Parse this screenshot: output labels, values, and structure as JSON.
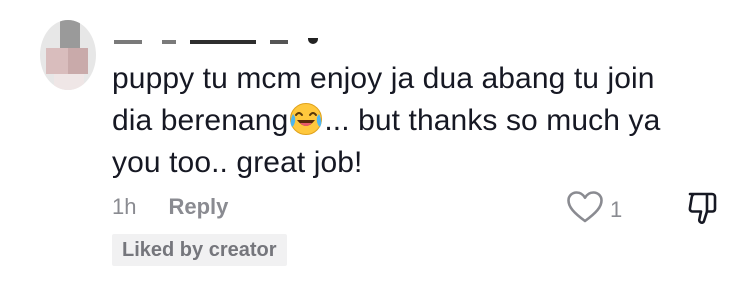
{
  "comment": {
    "text_line1": "puppy tu mcm enjoy ja dua abang tu join",
    "text_line2_before_emoji": "dia berenang",
    "emoji": "face-with-tears-of-joy",
    "text_line2_after_emoji": "... but thanks so much ya",
    "text_line3": "you too.. great job!",
    "time": "1h",
    "reply_label": "Reply",
    "like_count": "1",
    "creator_badge": "Liked by creator"
  },
  "icons": {
    "avatar": "avatar",
    "like": "heart-outline-icon",
    "dislike": "thumbs-down-icon",
    "emoji": "laughing-emoji-icon"
  },
  "colors": {
    "text": "#161823",
    "secondary": "#8a8b91",
    "badge_bg": "#f1f1f2"
  }
}
